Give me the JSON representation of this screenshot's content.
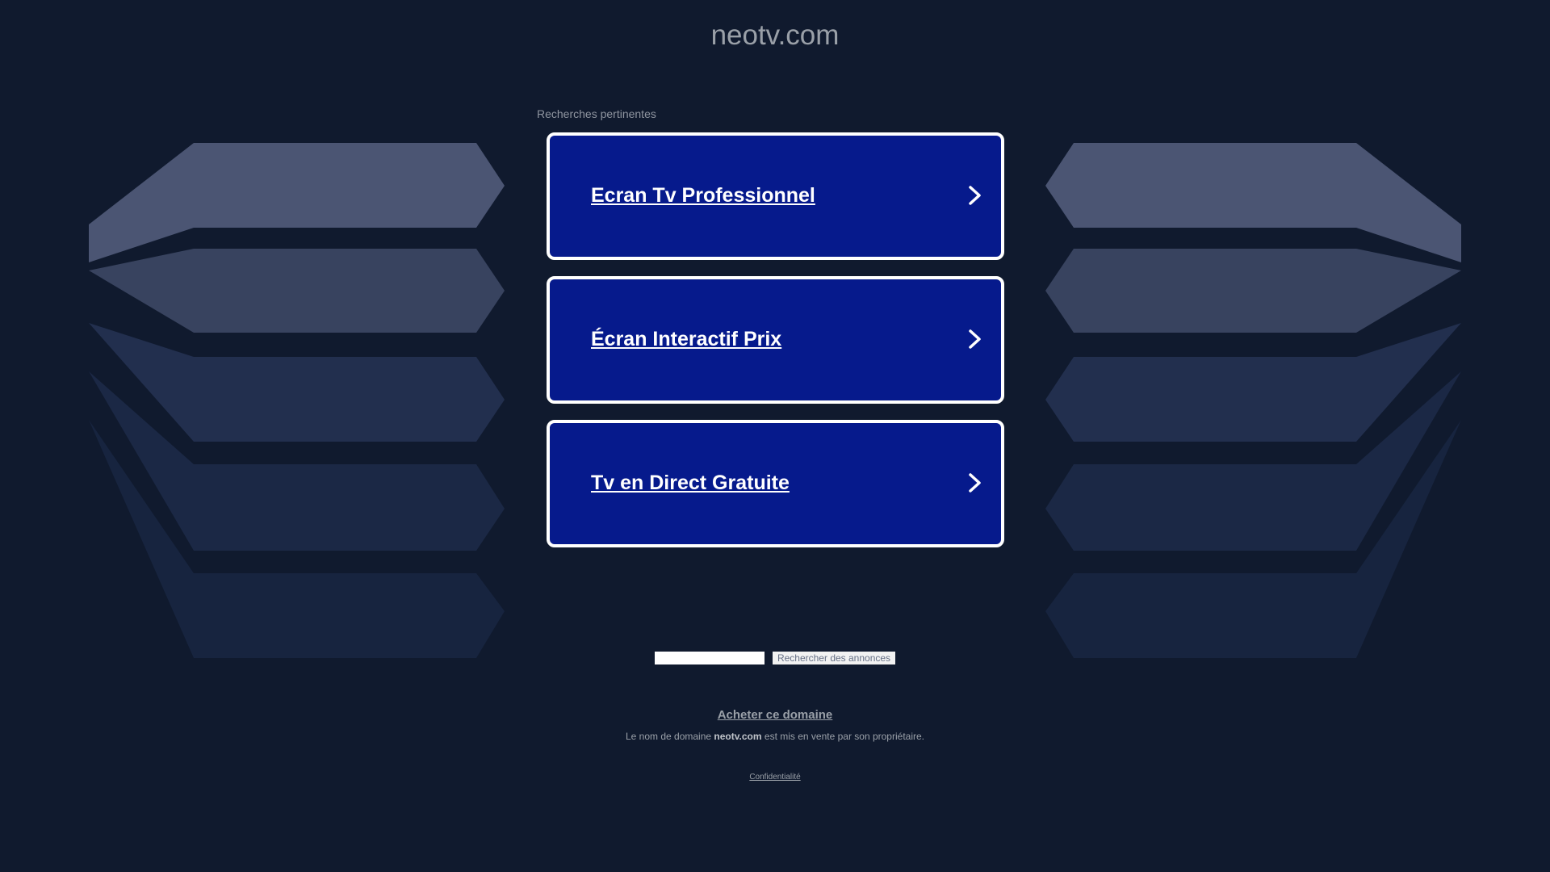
{
  "header": {
    "domain": "neotv.com"
  },
  "related": {
    "label": "Recherches pertinentes",
    "items": [
      {
        "label": "Ecran Tv Professionnel"
      },
      {
        "label": "Écran Interactif Prix"
      },
      {
        "label": "Tv en Direct Gratuite"
      }
    ]
  },
  "search": {
    "input_value": "",
    "button_label": "Rechercher des annonces"
  },
  "footer": {
    "buy_label": "Acheter ce domaine",
    "sale_prefix": "Le nom de domaine",
    "sale_domain": "neotv.com",
    "sale_suffix": "est mis en vente par son propriétaire.",
    "privacy_label": "Confidentialité"
  },
  "colors": {
    "background": "#101a2e",
    "card": "#061a8c",
    "card_border": "#ffffff"
  },
  "icons": {
    "chevron": "chevron-right-icon"
  }
}
